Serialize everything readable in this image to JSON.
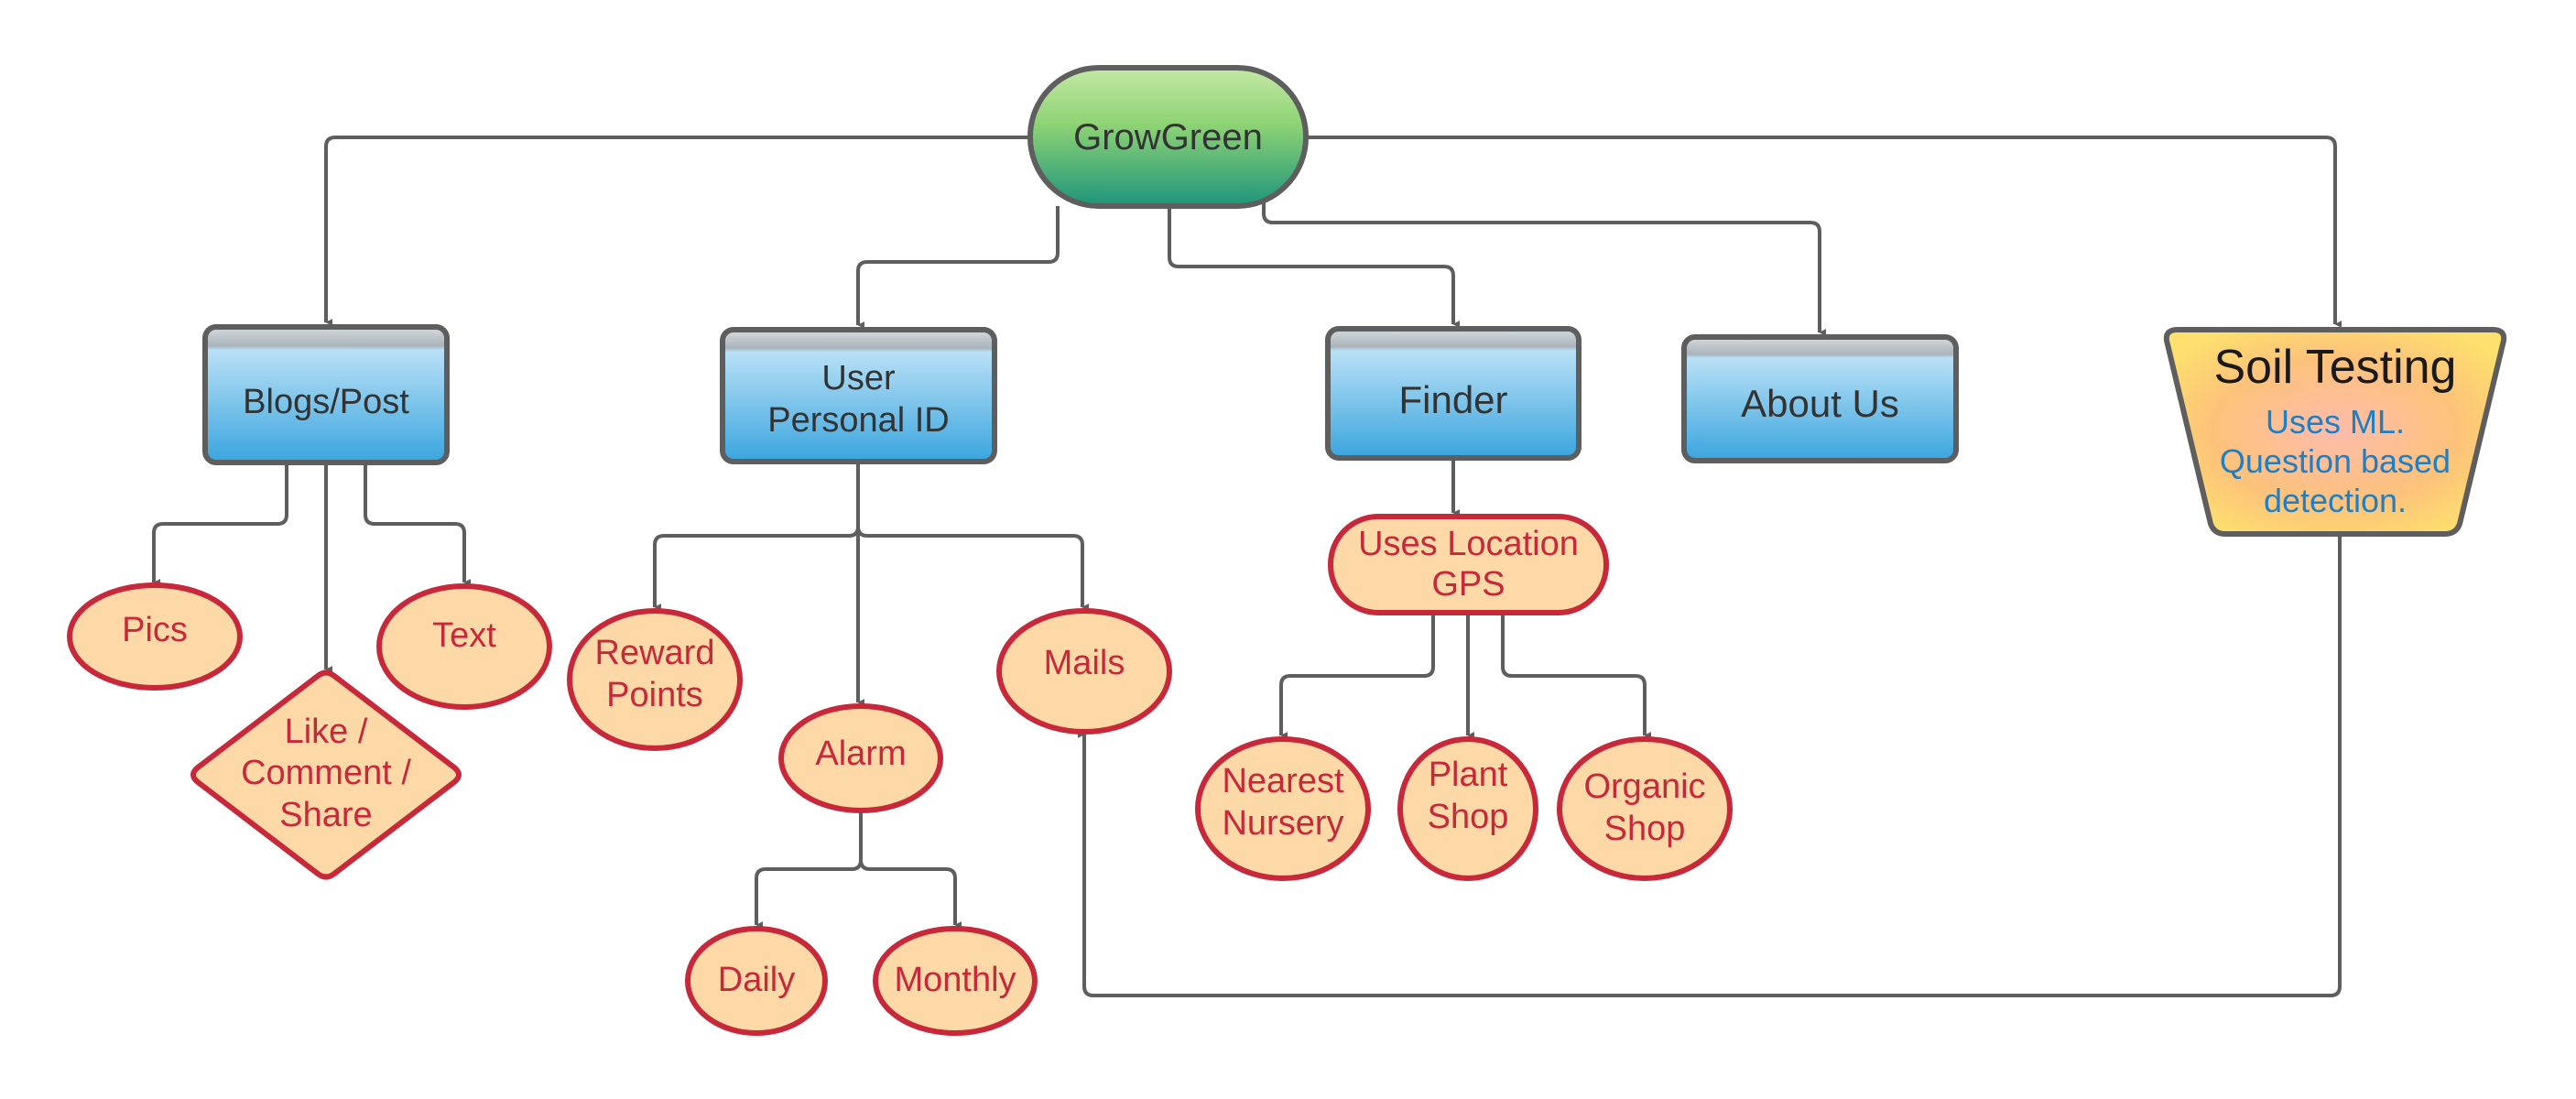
{
  "diagram": {
    "root": {
      "id": "growgreen",
      "label": "GrowGreen"
    },
    "modules": [
      {
        "id": "blogs",
        "label": "Blogs/Post"
      },
      {
        "id": "user",
        "label": "User\nPersonal ID"
      },
      {
        "id": "finder",
        "label": "Finder"
      },
      {
        "id": "about",
        "label": "About Us"
      },
      {
        "id": "soil",
        "title": "Soil Testing",
        "description": "Uses ML.\nQuestion based\ndetection."
      }
    ],
    "blogs_children": [
      {
        "id": "pics",
        "label": "Pics"
      },
      {
        "id": "like",
        "label": "Like /\nComment /\nShare"
      },
      {
        "id": "text",
        "label": "Text"
      }
    ],
    "user_children": [
      {
        "id": "reward",
        "label": "Reward\nPoints"
      },
      {
        "id": "alarm",
        "label": "Alarm"
      },
      {
        "id": "mails",
        "label": "Mails"
      }
    ],
    "alarm_children": [
      {
        "id": "daily",
        "label": "Daily"
      },
      {
        "id": "monthly",
        "label": "Monthly"
      }
    ],
    "finder_children": [
      {
        "id": "gps",
        "label": "Uses Location\nGPS"
      }
    ],
    "gps_children": [
      {
        "id": "nearest",
        "label": "Nearest\nNursery"
      },
      {
        "id": "plant",
        "label": "Plant\nShop"
      },
      {
        "id": "organic",
        "label": "Organic\nShop"
      }
    ],
    "edges": [
      [
        "growgreen",
        "blogs"
      ],
      [
        "growgreen",
        "user"
      ],
      [
        "growgreen",
        "finder"
      ],
      [
        "growgreen",
        "about"
      ],
      [
        "growgreen",
        "soil"
      ],
      [
        "blogs",
        "pics"
      ],
      [
        "blogs",
        "like"
      ],
      [
        "blogs",
        "text"
      ],
      [
        "user",
        "reward"
      ],
      [
        "user",
        "alarm"
      ],
      [
        "user",
        "mails"
      ],
      [
        "alarm",
        "daily"
      ],
      [
        "alarm",
        "monthly"
      ],
      [
        "finder",
        "gps"
      ],
      [
        "gps",
        "nearest"
      ],
      [
        "gps",
        "plant"
      ],
      [
        "gps",
        "organic"
      ],
      [
        "soil",
        "mails"
      ]
    ],
    "colors": {
      "edge": "#5e5e5e",
      "root_top": "#c4e8a6",
      "root_bottom": "#1e957b",
      "box_top": "#b9e0f6",
      "box_bottom": "#3aa5de",
      "box_band": "#aab4bb",
      "leaf_fill": "#fdd9a8",
      "leaf_stroke": "#c7283a",
      "leaf_text": "#c7283a",
      "soil_fill": "#fdc27a",
      "soil_text": "#1f7fc4"
    }
  }
}
